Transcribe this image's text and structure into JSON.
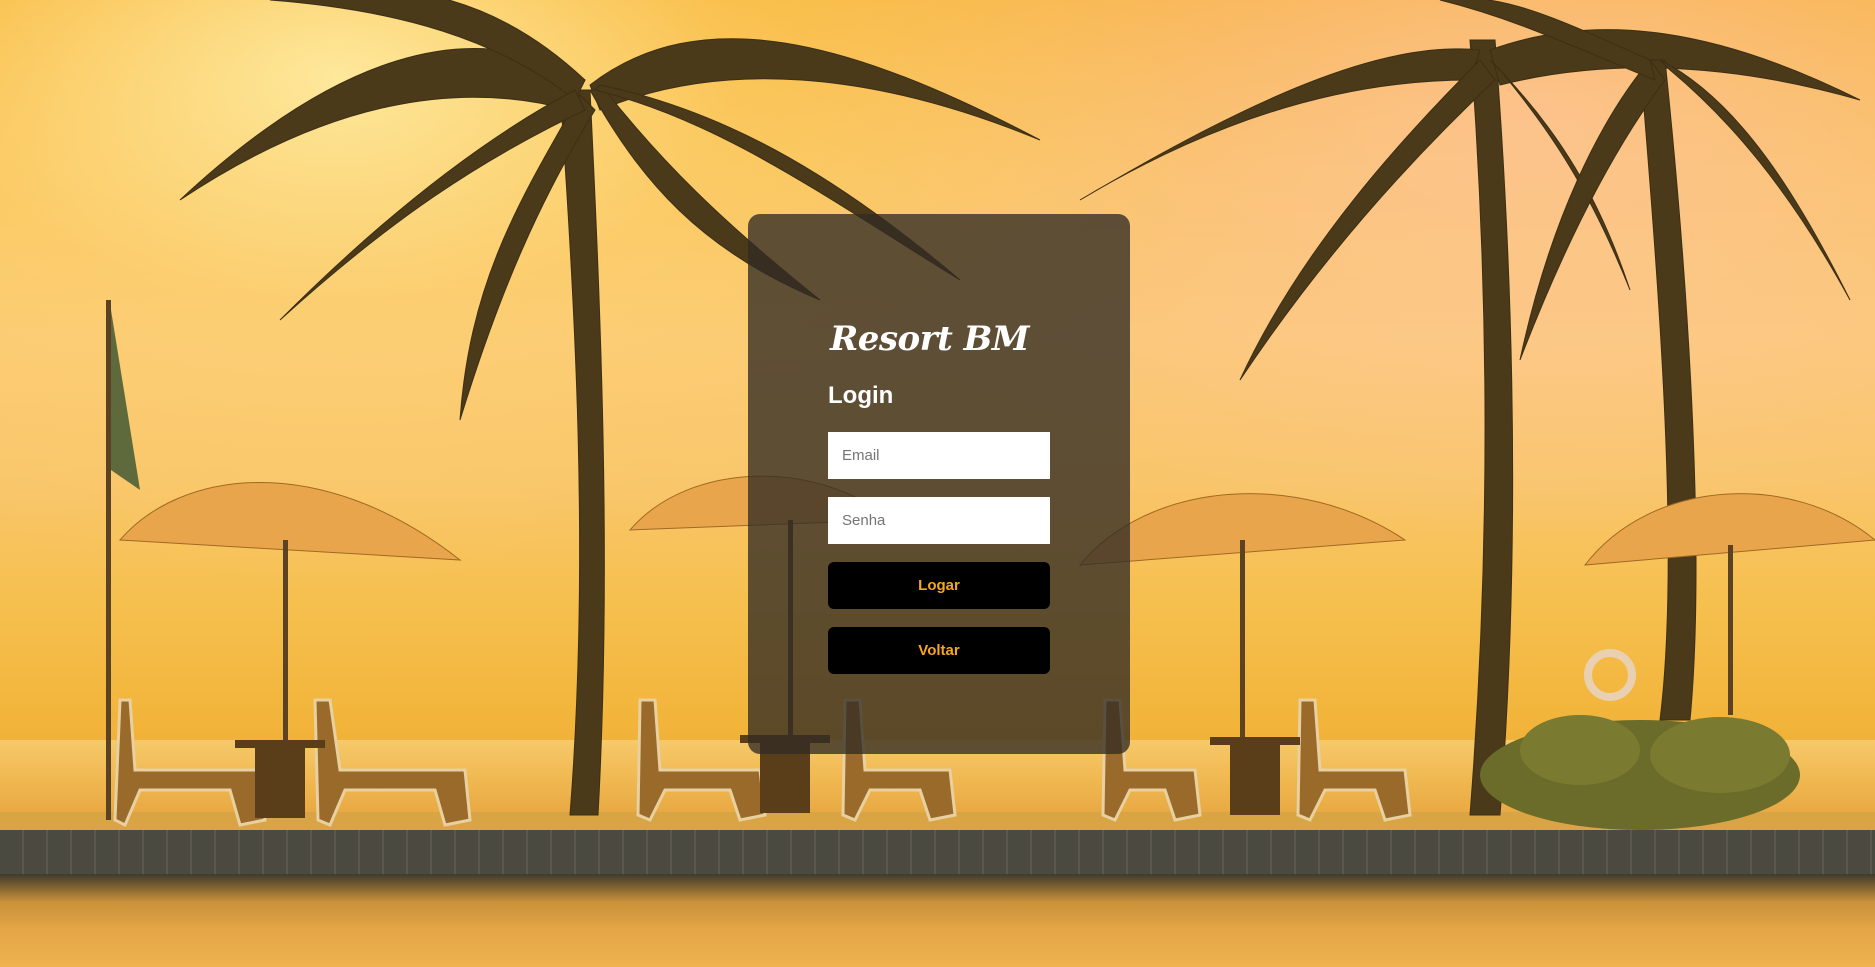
{
  "brand": {
    "name": "Resort BM"
  },
  "form": {
    "title": "Login",
    "email_placeholder": "Email",
    "password_placeholder": "Senha",
    "login_label": "Logar",
    "back_label": "Voltar"
  },
  "colors": {
    "panel_bg": "#322c24",
    "button_bg": "#000000",
    "button_text": "#f5a623",
    "text": "#ffffff"
  },
  "background": {
    "icons": [
      "palm-tree-icon",
      "beach-umbrella-icon",
      "lounge-chair-icon",
      "flag-icon",
      "bush-icon"
    ]
  }
}
